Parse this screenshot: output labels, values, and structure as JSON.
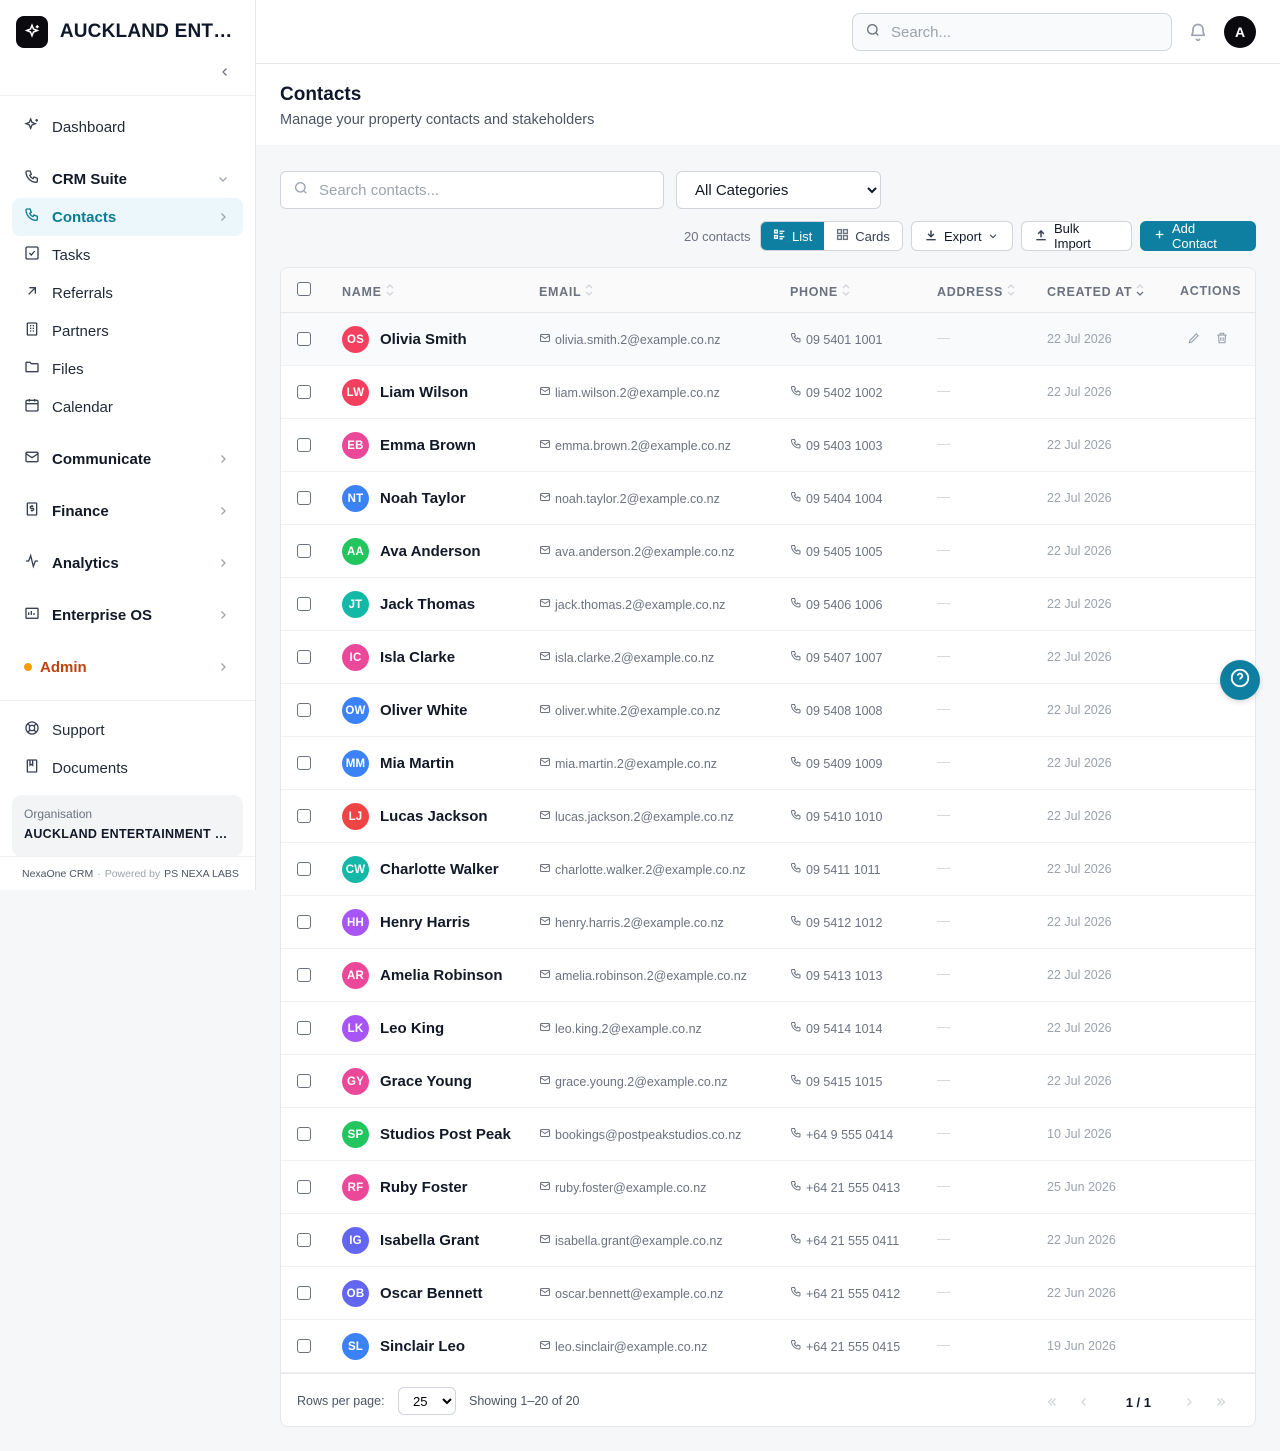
{
  "brand": {
    "title": "AUCKLAND ENTERTAINMENT CO."
  },
  "sidebar": {
    "dashboard": "Dashboard",
    "crm_suite": "CRM Suite",
    "crm_items": [
      "Contacts",
      "Tasks",
      "Referrals",
      "Partners",
      "Files",
      "Calendar"
    ],
    "groups": [
      "Communicate",
      "Finance",
      "Analytics",
      "Enterprise OS"
    ],
    "admin": "Admin",
    "support": "Support",
    "documents": "Documents",
    "org_label": "Organisation",
    "org_name": "AUCKLAND ENTERTAINMENT CO.",
    "footer_app": "NexaOne CRM",
    "footer_sep": "·",
    "footer_powered": "Powered by",
    "footer_company": "PS NEXA LABS"
  },
  "topbar": {
    "search_placeholder": "Search...",
    "avatar_initial": "A"
  },
  "page": {
    "title": "Contacts",
    "subtitle": "Manage your property contacts and stakeholders"
  },
  "filters": {
    "search_placeholder": "Search contacts...",
    "category_selected": "All Categories"
  },
  "toolbar": {
    "count": "20 contacts",
    "list": "List",
    "cards": "Cards",
    "export": "Export",
    "bulk_import": "Bulk Import",
    "add_contact": "Add Contact"
  },
  "table": {
    "headers": {
      "name": "NAME",
      "email": "EMAIL",
      "phone": "PHONE",
      "address": "ADDRESS",
      "created": "CREATED AT",
      "actions": "ACTIONS"
    },
    "rows": [
      {
        "initials": "OS",
        "color": "#f43f5e",
        "name": "Olivia Smith",
        "email": "olivia.smith.2@example.co.nz",
        "phone": "09 5401 1001",
        "address": "—",
        "created": "22 Jul 2026"
      },
      {
        "initials": "LW",
        "color": "#f43f5e",
        "name": "Liam Wilson",
        "email": "liam.wilson.2@example.co.nz",
        "phone": "09 5402 1002",
        "address": "—",
        "created": "22 Jul 2026"
      },
      {
        "initials": "EB",
        "color": "#ec4899",
        "name": "Emma Brown",
        "email": "emma.brown.2@example.co.nz",
        "phone": "09 5403 1003",
        "address": "—",
        "created": "22 Jul 2026"
      },
      {
        "initials": "NT",
        "color": "#3b82f6",
        "name": "Noah Taylor",
        "email": "noah.taylor.2@example.co.nz",
        "phone": "09 5404 1004",
        "address": "—",
        "created": "22 Jul 2026"
      },
      {
        "initials": "AA",
        "color": "#22c55e",
        "name": "Ava Anderson",
        "email": "ava.anderson.2@example.co.nz",
        "phone": "09 5405 1005",
        "address": "—",
        "created": "22 Jul 2026"
      },
      {
        "initials": "JT",
        "color": "#14b8a6",
        "name": "Jack Thomas",
        "email": "jack.thomas.2@example.co.nz",
        "phone": "09 5406 1006",
        "address": "—",
        "created": "22 Jul 2026"
      },
      {
        "initials": "IC",
        "color": "#ec4899",
        "name": "Isla Clarke",
        "email": "isla.clarke.2@example.co.nz",
        "phone": "09 5407 1007",
        "address": "—",
        "created": "22 Jul 2026"
      },
      {
        "initials": "OW",
        "color": "#3b82f6",
        "name": "Oliver White",
        "email": "oliver.white.2@example.co.nz",
        "phone": "09 5408 1008",
        "address": "—",
        "created": "22 Jul 2026"
      },
      {
        "initials": "MM",
        "color": "#3b82f6",
        "name": "Mia Martin",
        "email": "mia.martin.2@example.co.nz",
        "phone": "09 5409 1009",
        "address": "—",
        "created": "22 Jul 2026"
      },
      {
        "initials": "LJ",
        "color": "#ef4444",
        "name": "Lucas Jackson",
        "email": "lucas.jackson.2@example.co.nz",
        "phone": "09 5410 1010",
        "address": "—",
        "created": "22 Jul 2026"
      },
      {
        "initials": "CW",
        "color": "#14b8a6",
        "name": "Charlotte Walker",
        "email": "charlotte.walker.2@example.co.nz",
        "phone": "09 5411 1011",
        "address": "—",
        "created": "22 Jul 2026"
      },
      {
        "initials": "HH",
        "color": "#a855f7",
        "name": "Henry Harris",
        "email": "henry.harris.2@example.co.nz",
        "phone": "09 5412 1012",
        "address": "—",
        "created": "22 Jul 2026"
      },
      {
        "initials": "AR",
        "color": "#ec4899",
        "name": "Amelia Robinson",
        "email": "amelia.robinson.2@example.co.nz",
        "phone": "09 5413 1013",
        "address": "—",
        "created": "22 Jul 2026"
      },
      {
        "initials": "LK",
        "color": "#a855f7",
        "name": "Leo King",
        "email": "leo.king.2@example.co.nz",
        "phone": "09 5414 1014",
        "address": "—",
        "created": "22 Jul 2026"
      },
      {
        "initials": "GY",
        "color": "#ec4899",
        "name": "Grace Young",
        "email": "grace.young.2@example.co.nz",
        "phone": "09 5415 1015",
        "address": "—",
        "created": "22 Jul 2026"
      },
      {
        "initials": "SP",
        "color": "#22c55e",
        "name": "Studios Post Peak",
        "email": "bookings@postpeakstudios.co.nz",
        "phone": "+64 9 555 0414",
        "address": "—",
        "created": "10 Jul 2026"
      },
      {
        "initials": "RF",
        "color": "#ec4899",
        "name": "Ruby Foster",
        "email": "ruby.foster@example.co.nz",
        "phone": "+64 21 555 0413",
        "address": "—",
        "created": "25 Jun 2026"
      },
      {
        "initials": "IG",
        "color": "#6366f1",
        "name": "Isabella Grant",
        "email": "isabella.grant@example.co.nz",
        "phone": "+64 21 555 0411",
        "address": "—",
        "created": "22 Jun 2026"
      },
      {
        "initials": "OB",
        "color": "#6366f1",
        "name": "Oscar Bennett",
        "email": "oscar.bennett@example.co.nz",
        "phone": "+64 21 555 0412",
        "address": "—",
        "created": "22 Jun 2026"
      },
      {
        "initials": "SL",
        "color": "#3b82f6",
        "name": "Sinclair Leo",
        "email": "leo.sinclair@example.co.nz",
        "phone": "+64 21 555 0415",
        "address": "—",
        "created": "19 Jun 2026"
      }
    ]
  },
  "footer": {
    "rows_per_page_label": "Rows per page:",
    "rows_per_page": "25",
    "showing": "Showing 1–20 of 20",
    "page": "1 / 1"
  },
  "colors": {
    "accent": "#0e7fa0",
    "admin": "#c2410c"
  }
}
